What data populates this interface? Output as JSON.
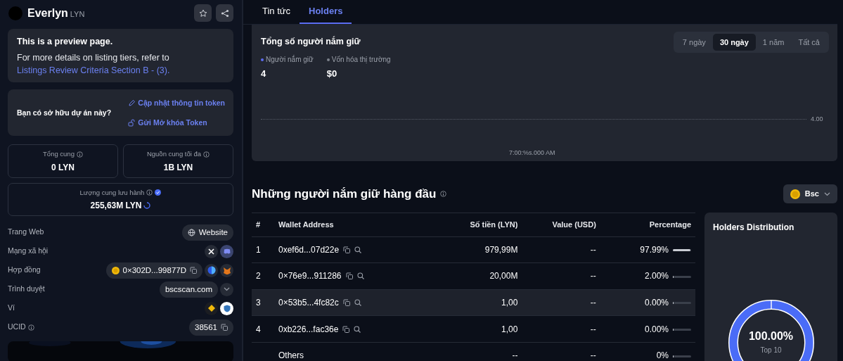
{
  "token": {
    "name": "Everlyn",
    "symbol": "LYN"
  },
  "notice": {
    "title": "This is a preview page.",
    "text": "For more details on listing tiers, refer to",
    "link": "Listings Review Criteria Section B - (3)."
  },
  "ownership": {
    "question": "Bạn có sở hữu dự án này?",
    "links": [
      {
        "label": "Cập nhật thông tin token",
        "kind": "edit"
      },
      {
        "label": "Gửi Mở khóa Token",
        "kind": "unlock"
      }
    ]
  },
  "supply": [
    {
      "label": "Tổng cung",
      "value": "0 LYN",
      "verified": false
    },
    {
      "label": "Nguồn cung tối đa",
      "value": "1B LYN",
      "verified": false
    },
    {
      "label": "Lượng cung lưu hành",
      "value": "255,63M LYN",
      "verified": true
    }
  ],
  "info_rows": [
    {
      "label": "Trang Web",
      "kind": "website",
      "value": "Website"
    },
    {
      "label": "Mạng xã hội",
      "kind": "social"
    },
    {
      "label": "Hợp đồng",
      "kind": "contract",
      "value": "0×302D...99877D"
    },
    {
      "label": "Trình duyệt",
      "kind": "explorer",
      "value": "bscscan.com"
    },
    {
      "label": "Ví",
      "kind": "wallets"
    },
    {
      "label": "UCID",
      "kind": "ucid",
      "value": "38561"
    }
  ],
  "tabs": [
    {
      "label": "Tin tức",
      "selected": false
    },
    {
      "label": "Holders",
      "selected": true
    }
  ],
  "holders_chart": {
    "title": "Tổng số người nắm giữ",
    "periods": [
      {
        "label": "7 ngày",
        "selected": false
      },
      {
        "label": "30 ngày",
        "selected": true
      },
      {
        "label": "1 năm",
        "selected": false
      },
      {
        "label": "Tất cả",
        "selected": false
      }
    ],
    "legend": [
      {
        "label": "Người nắm giữ",
        "value": "4",
        "color": "#5b6cf0"
      },
      {
        "label": "Vốn hóa thị trường",
        "value": "$0",
        "color": "#7d828c"
      }
    ],
    "y_label": "4.00",
    "x_label": "7:00:%s.000 AM"
  },
  "top_holders": {
    "title": "Những người nắm giữ hàng đầu",
    "chain": "Bsc",
    "columns": [
      "#",
      "Wallet Address",
      "Số tiền (LYN)",
      "Value (USD)",
      "Percentage"
    ],
    "rows": [
      {
        "kind": "wallet",
        "rank": "1",
        "address": "0xef6d...07d22e",
        "amount": "979,99M",
        "value": "--",
        "percentage": "97.99%",
        "level": 0.9799,
        "selected": false
      },
      {
        "kind": "wallet",
        "rank": "2",
        "address": "0×76e9...911286",
        "amount": "20,00M",
        "value": "--",
        "percentage": "2.00%",
        "level": 0.02,
        "selected": false
      },
      {
        "kind": "wallet",
        "rank": "3",
        "address": "0×53b5...4fc82c",
        "amount": "1,00",
        "value": "--",
        "percentage": "0.00%",
        "level": 0,
        "selected": true
      },
      {
        "kind": "wallet",
        "rank": "4",
        "address": "0xb226...fac36e",
        "amount": "1,00",
        "value": "--",
        "percentage": "0.00%",
        "level": 0,
        "selected": false
      },
      {
        "kind": "others",
        "address": "Others",
        "amount": "--",
        "value": "--",
        "percentage": "0%",
        "level": 0,
        "selected": false
      }
    ]
  },
  "distribution": {
    "title": "Holders Distribution",
    "percent": "100.00%",
    "caption": "Top 10"
  }
}
